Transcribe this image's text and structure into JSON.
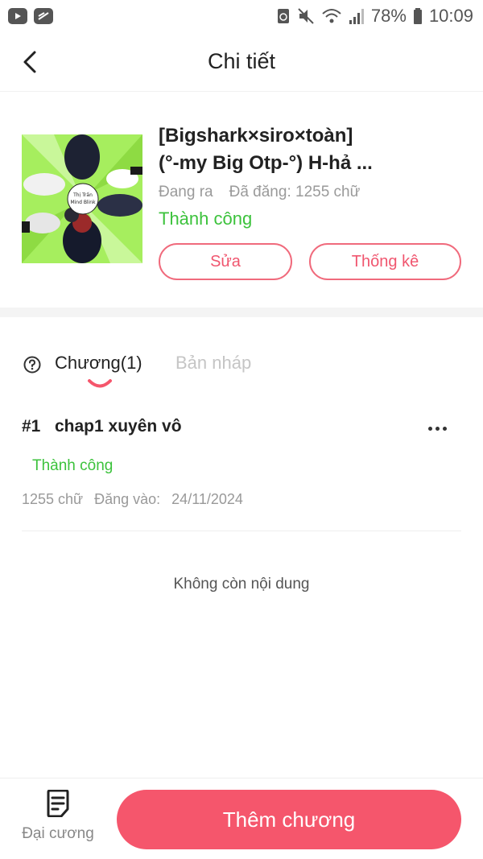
{
  "status_bar": {
    "battery": "78%",
    "time": "10:09"
  },
  "header": {
    "title": "Chi tiết"
  },
  "book": {
    "title_line1": "[Bigshark×siro×toàn]",
    "title_line2": "(°-my Big Otp-°) H-hả ...",
    "state": "Đang ra",
    "words": "Đã đăng: 1255 chữ",
    "status": "Thành công",
    "edit_label": "Sửa",
    "stats_label": "Thống kê",
    "cover_text_1": "Thị Trấn",
    "cover_text_2": "Mind Blink"
  },
  "tabs": {
    "chapters": "Chương(1)",
    "drafts": "Bản nháp"
  },
  "chapters": [
    {
      "number": "#1",
      "title": "chap1 xuyên vô",
      "status": "Thành công",
      "words": "1255 chữ",
      "posted_label": "Đăng vào:",
      "posted_date": "24/11/2024"
    }
  ],
  "list_end_text": "Không còn nội dung",
  "bottom_bar": {
    "outline_label": "Đại cương",
    "add_chapter_label": "Thêm chương"
  },
  "colors": {
    "accent": "#f5566c",
    "success": "#3cc23c"
  }
}
